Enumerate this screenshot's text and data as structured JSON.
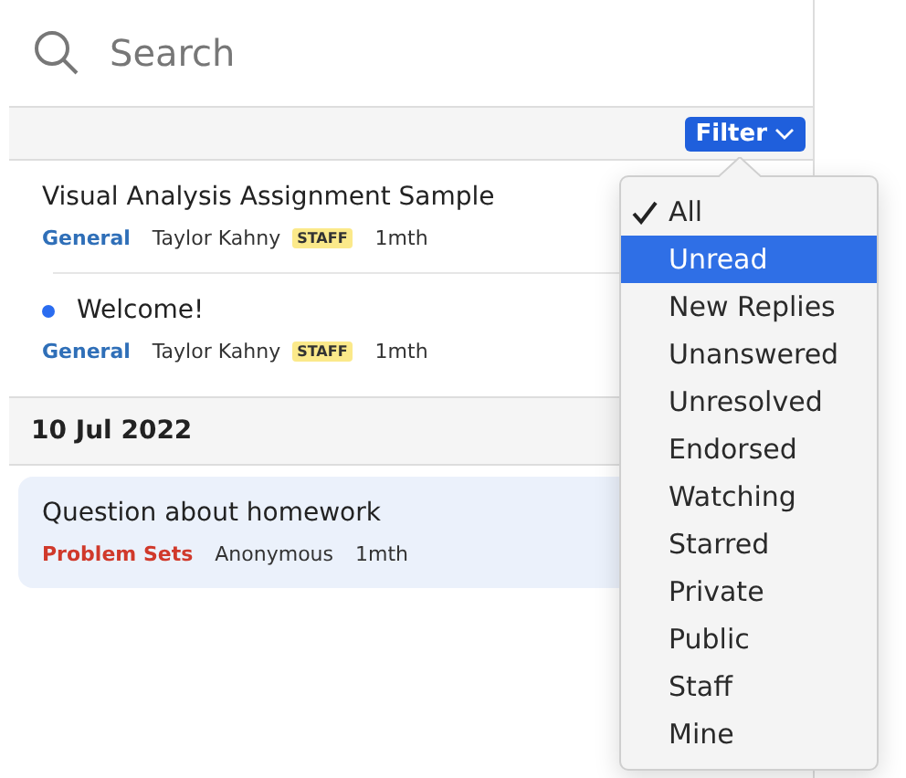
{
  "search": {
    "placeholder": "Search"
  },
  "filter_button": {
    "label": "Filter"
  },
  "posts": [
    {
      "title": "Visual Analysis Assignment Sample",
      "unread": false,
      "selected": false,
      "category": "General",
      "color": "#2f6fb8",
      "author": "Taylor Kahny",
      "badge": "STAFF",
      "time": "1mth"
    },
    {
      "title": "Welcome!",
      "unread": true,
      "selected": false,
      "category": "General",
      "color": "#2f6fb8",
      "author": "Taylor Kahny",
      "badge": "STAFF",
      "time": "1mth"
    }
  ],
  "date_header": "10 Jul 2022",
  "posts_after": [
    {
      "title": "Question about homework",
      "unread": false,
      "selected": true,
      "category": "Problem Sets",
      "color": "#d0392b",
      "author": "Anonymous",
      "time": "1mth"
    }
  ],
  "filter_menu": [
    {
      "label": "All",
      "checked": true,
      "highlighted": false
    },
    {
      "label": "Unread",
      "checked": false,
      "highlighted": true
    },
    {
      "label": "New Replies",
      "checked": false,
      "highlighted": false
    },
    {
      "label": "Unanswered",
      "checked": false,
      "highlighted": false
    },
    {
      "label": "Unresolved",
      "checked": false,
      "highlighted": false
    },
    {
      "label": "Endorsed",
      "checked": false,
      "highlighted": false
    },
    {
      "label": "Watching",
      "checked": false,
      "highlighted": false
    },
    {
      "label": "Starred",
      "checked": false,
      "highlighted": false
    },
    {
      "label": "Private",
      "checked": false,
      "highlighted": false
    },
    {
      "label": "Public",
      "checked": false,
      "highlighted": false
    },
    {
      "label": "Staff",
      "checked": false,
      "highlighted": false
    },
    {
      "label": "Mine",
      "checked": false,
      "highlighted": false
    }
  ]
}
